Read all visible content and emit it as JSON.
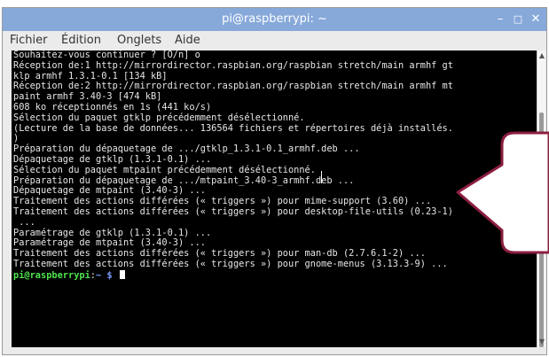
{
  "window": {
    "title": "pi@raspberrypi: ~",
    "controls": {
      "minimize": "–",
      "maximize": "□",
      "close": "✕"
    }
  },
  "menu": [
    "Fichier",
    "Édition",
    "Onglets",
    "Aide"
  ],
  "terminal": {
    "lines": [
      "Souhaitez-vous continuer ? [O/n] o",
      "Réception de:1 http://mirrordirector.raspbian.org/raspbian stretch/main armhf gt",
      "klp armhf 1.3.1-0.1 [134 kB]",
      "Réception de:2 http://mirrordirector.raspbian.org/raspbian stretch/main armhf mt",
      "paint armhf 3.40-3 [474 kB]",
      "608 ko réceptionnés en 1s (441 ko/s)",
      "Sélection du paquet gtklp précédemment désélectionné.",
      "(Lecture de la base de données... 136564 fichiers et répertoires déjà installés.",
      ")",
      "Préparation du dépaquetage de .../gtklp_1.3.1-0.1_armhf.deb ...",
      "Dépaquetage de gtklp (1.3.1-0.1) ...",
      "Sélection du paquet mtpaint précédemment désélectionné.",
      "Préparation du dépaquetage de .../mtpaint_3.40-3_armhf.deb ...",
      "Dépaquetage de mtpaint (3.40-3) ...",
      "Traitement des actions différées (« triggers ») pour mime-support (3.60) ...",
      "Traitement des actions différées (« triggers ») pour desktop-file-utils (0.23-1)",
      " ...",
      "Paramétrage de gtklp (1.3.1-0.1) ...",
      "Paramétrage de mtpaint (3.40-3) ...",
      "Traitement des actions différées (« triggers ») pour man-db (2.7.6.1-2) ...",
      "Traitement des actions différées (« triggers ») pour gnome-menus (3.13.3-9) ..."
    ],
    "prompt_user": "pi@raspberrypi",
    "prompt_sep": ":",
    "prompt_path": "~ $"
  },
  "scrollbar": {
    "up_icon": "▲",
    "down_icon": "▼"
  },
  "colors": {
    "titlebar": "#87a9da",
    "terminal_bg": "#000000",
    "terminal_text": "#e6e6e6",
    "prompt": "#4ee44e",
    "path": "#7b9cff",
    "callout_border": "#8b1e3f"
  }
}
